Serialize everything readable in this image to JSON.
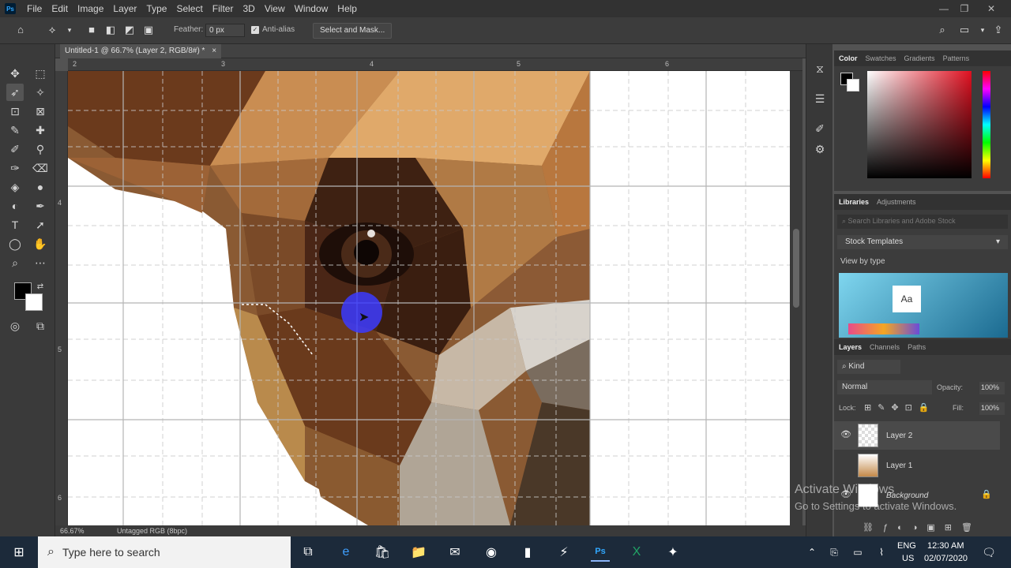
{
  "app": {
    "logo": "Ps"
  },
  "menubar": {
    "items": [
      "File",
      "Edit",
      "Image",
      "Layer",
      "Type",
      "Select",
      "Filter",
      "3D",
      "View",
      "Window",
      "Help"
    ]
  },
  "options": {
    "feather_label": "Feather:",
    "feather_value": "0 px",
    "antialias_label": "Anti-alias",
    "select_mask_label": "Select and Mask..."
  },
  "document": {
    "tab_title": "Untitled-1 @ 66.7% (Layer 2, RGB/8#) *",
    "close": "×",
    "ruler_top": [
      "2",
      "3",
      "4",
      "5",
      "6"
    ],
    "ruler_left": [
      "4",
      "5",
      "6"
    ],
    "zoom": "66.67%",
    "profile": "Untagged RGB (8bpc)"
  },
  "color_panel": {
    "tabs": [
      "Color",
      "Swatches",
      "Gradients",
      "Patterns"
    ]
  },
  "libraries_panel": {
    "tabs": [
      "Libraries",
      "Adjustments"
    ],
    "search_placeholder": "Search Libraries and Adobe Stock",
    "dropdown": "Stock Templates",
    "view_by": "View by type",
    "thumb_text": "Aa"
  },
  "layers_panel": {
    "tabs": [
      "Layers",
      "Channels",
      "Paths"
    ],
    "filter": "Kind",
    "blend_mode": "Normal",
    "opacity_label": "Opacity:",
    "opacity_value": "100%",
    "lock_label": "Lock:",
    "fill_label": "Fill:",
    "fill_value": "100%",
    "layers": [
      {
        "name": "Layer 2"
      },
      {
        "name": "Layer 1"
      },
      {
        "name": "Background"
      }
    ]
  },
  "watermark": {
    "line1": "Activate Windows",
    "line2": "Go to Settings to activate Windows."
  },
  "taskbar": {
    "search_placeholder": "Type here to search",
    "lang": "ENG",
    "region": "US",
    "time": "12:30 AM",
    "date": "02/07/2020"
  },
  "colors": {
    "accent": "#31a8ff",
    "foreground": "#000000",
    "background": "#ffffff",
    "brush_cursor": "#3b3bff"
  }
}
